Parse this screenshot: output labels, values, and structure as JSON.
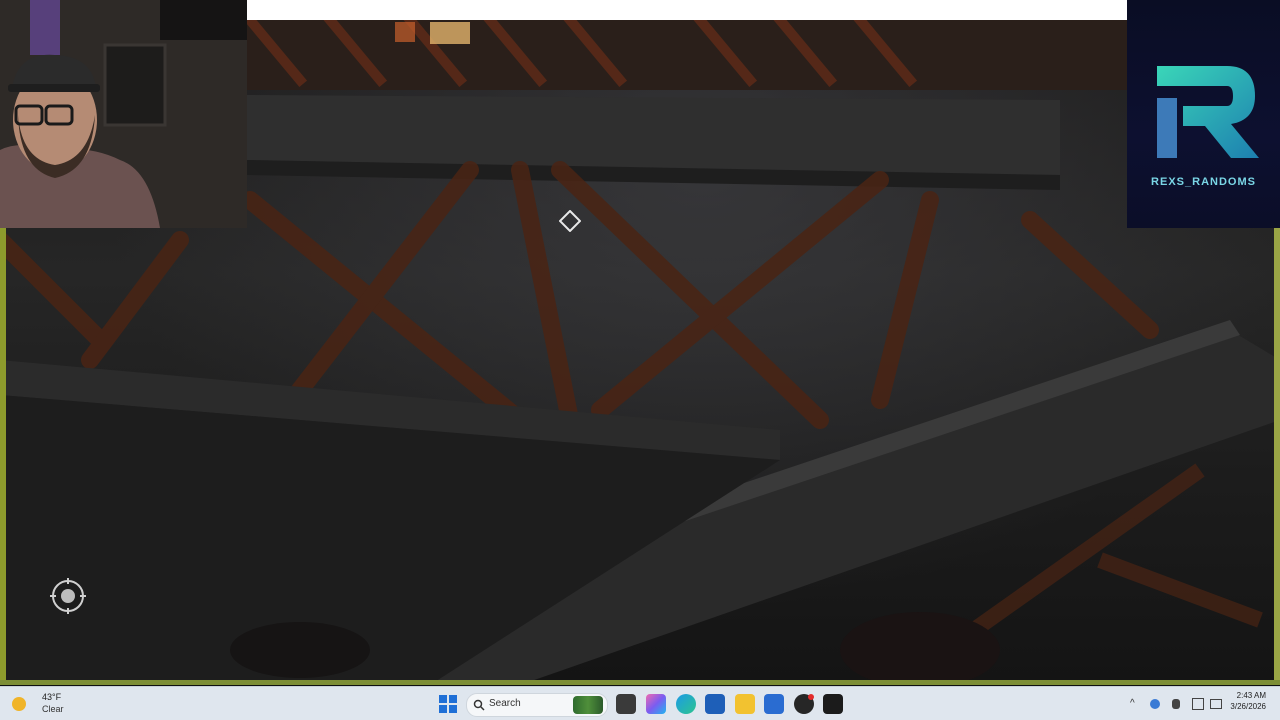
{
  "overlay": {
    "brand_name": "REXS_RANDOMS"
  },
  "hud": {
    "waypoint_icon": "diamond-waypoint-icon",
    "compass_icon": "compass-reticle-icon"
  },
  "taskbar": {
    "weather": {
      "temp": "43°F",
      "condition": "Clear",
      "icon": "moon-weather-icon"
    },
    "search_label": "Search",
    "pinned_apps": [
      "start-icon",
      "task-view-icon",
      "copilot-icon",
      "edge-icon",
      "store-icon",
      "file-explorer-icon",
      "app-icon",
      "app-red-badge-icon",
      "game-app-icon"
    ],
    "clock": {
      "time": "2:43 AM",
      "date": "3/26/2026"
    }
  },
  "colors": {
    "taskbar_bg": "#dfe6ee",
    "logo_bg": "#0b0e28",
    "logo_accent": "#3ad6b8",
    "chroma_edge": "#8d9b2c"
  }
}
